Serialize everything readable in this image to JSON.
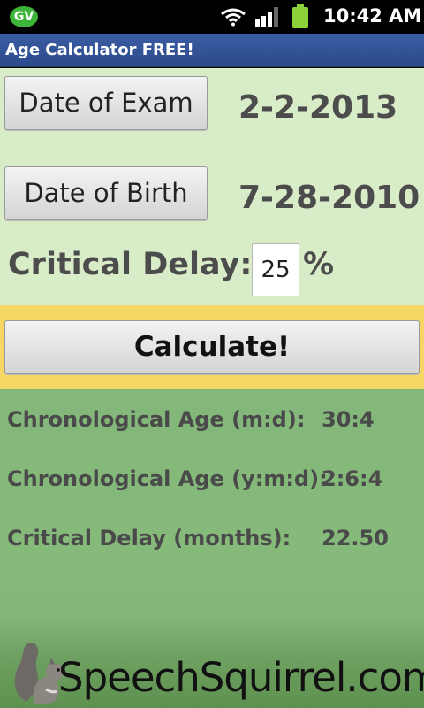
{
  "status_bar": {
    "gv_label": "GV",
    "time": "10:42 AM",
    "icons": [
      "gv-icon",
      "wifi-icon",
      "signal-icon",
      "battery-icon"
    ]
  },
  "app": {
    "title": "Age Calculator FREE!"
  },
  "form": {
    "exam_button_label": "Date of Exam",
    "exam_date": "2-2-2013",
    "birth_button_label": "Date of Birth",
    "birth_date": "7-28-2010",
    "delay_label": "Critical Delay:",
    "delay_value": "25",
    "delay_unit": "%"
  },
  "calculate_label": "Calculate!",
  "results": [
    {
      "label": "Chronological Age (m:d):",
      "value": "30:4"
    },
    {
      "label": "Chronological Age (y:m:d):",
      "value": "2:6:4"
    },
    {
      "label": "Critical Delay (months):",
      "value": "22.50"
    }
  ],
  "footer": {
    "brand": "SpeechSquirrel.com",
    "mascot_icon": "squirrel-icon"
  },
  "colors": {
    "title_bar": "#2c4a8c",
    "top_section": "#d9ecc8",
    "calc_band": "#f7d764",
    "results_section": "#86ba7b",
    "gv_badge": "#3fb43a",
    "battery": "#8bd13a"
  }
}
